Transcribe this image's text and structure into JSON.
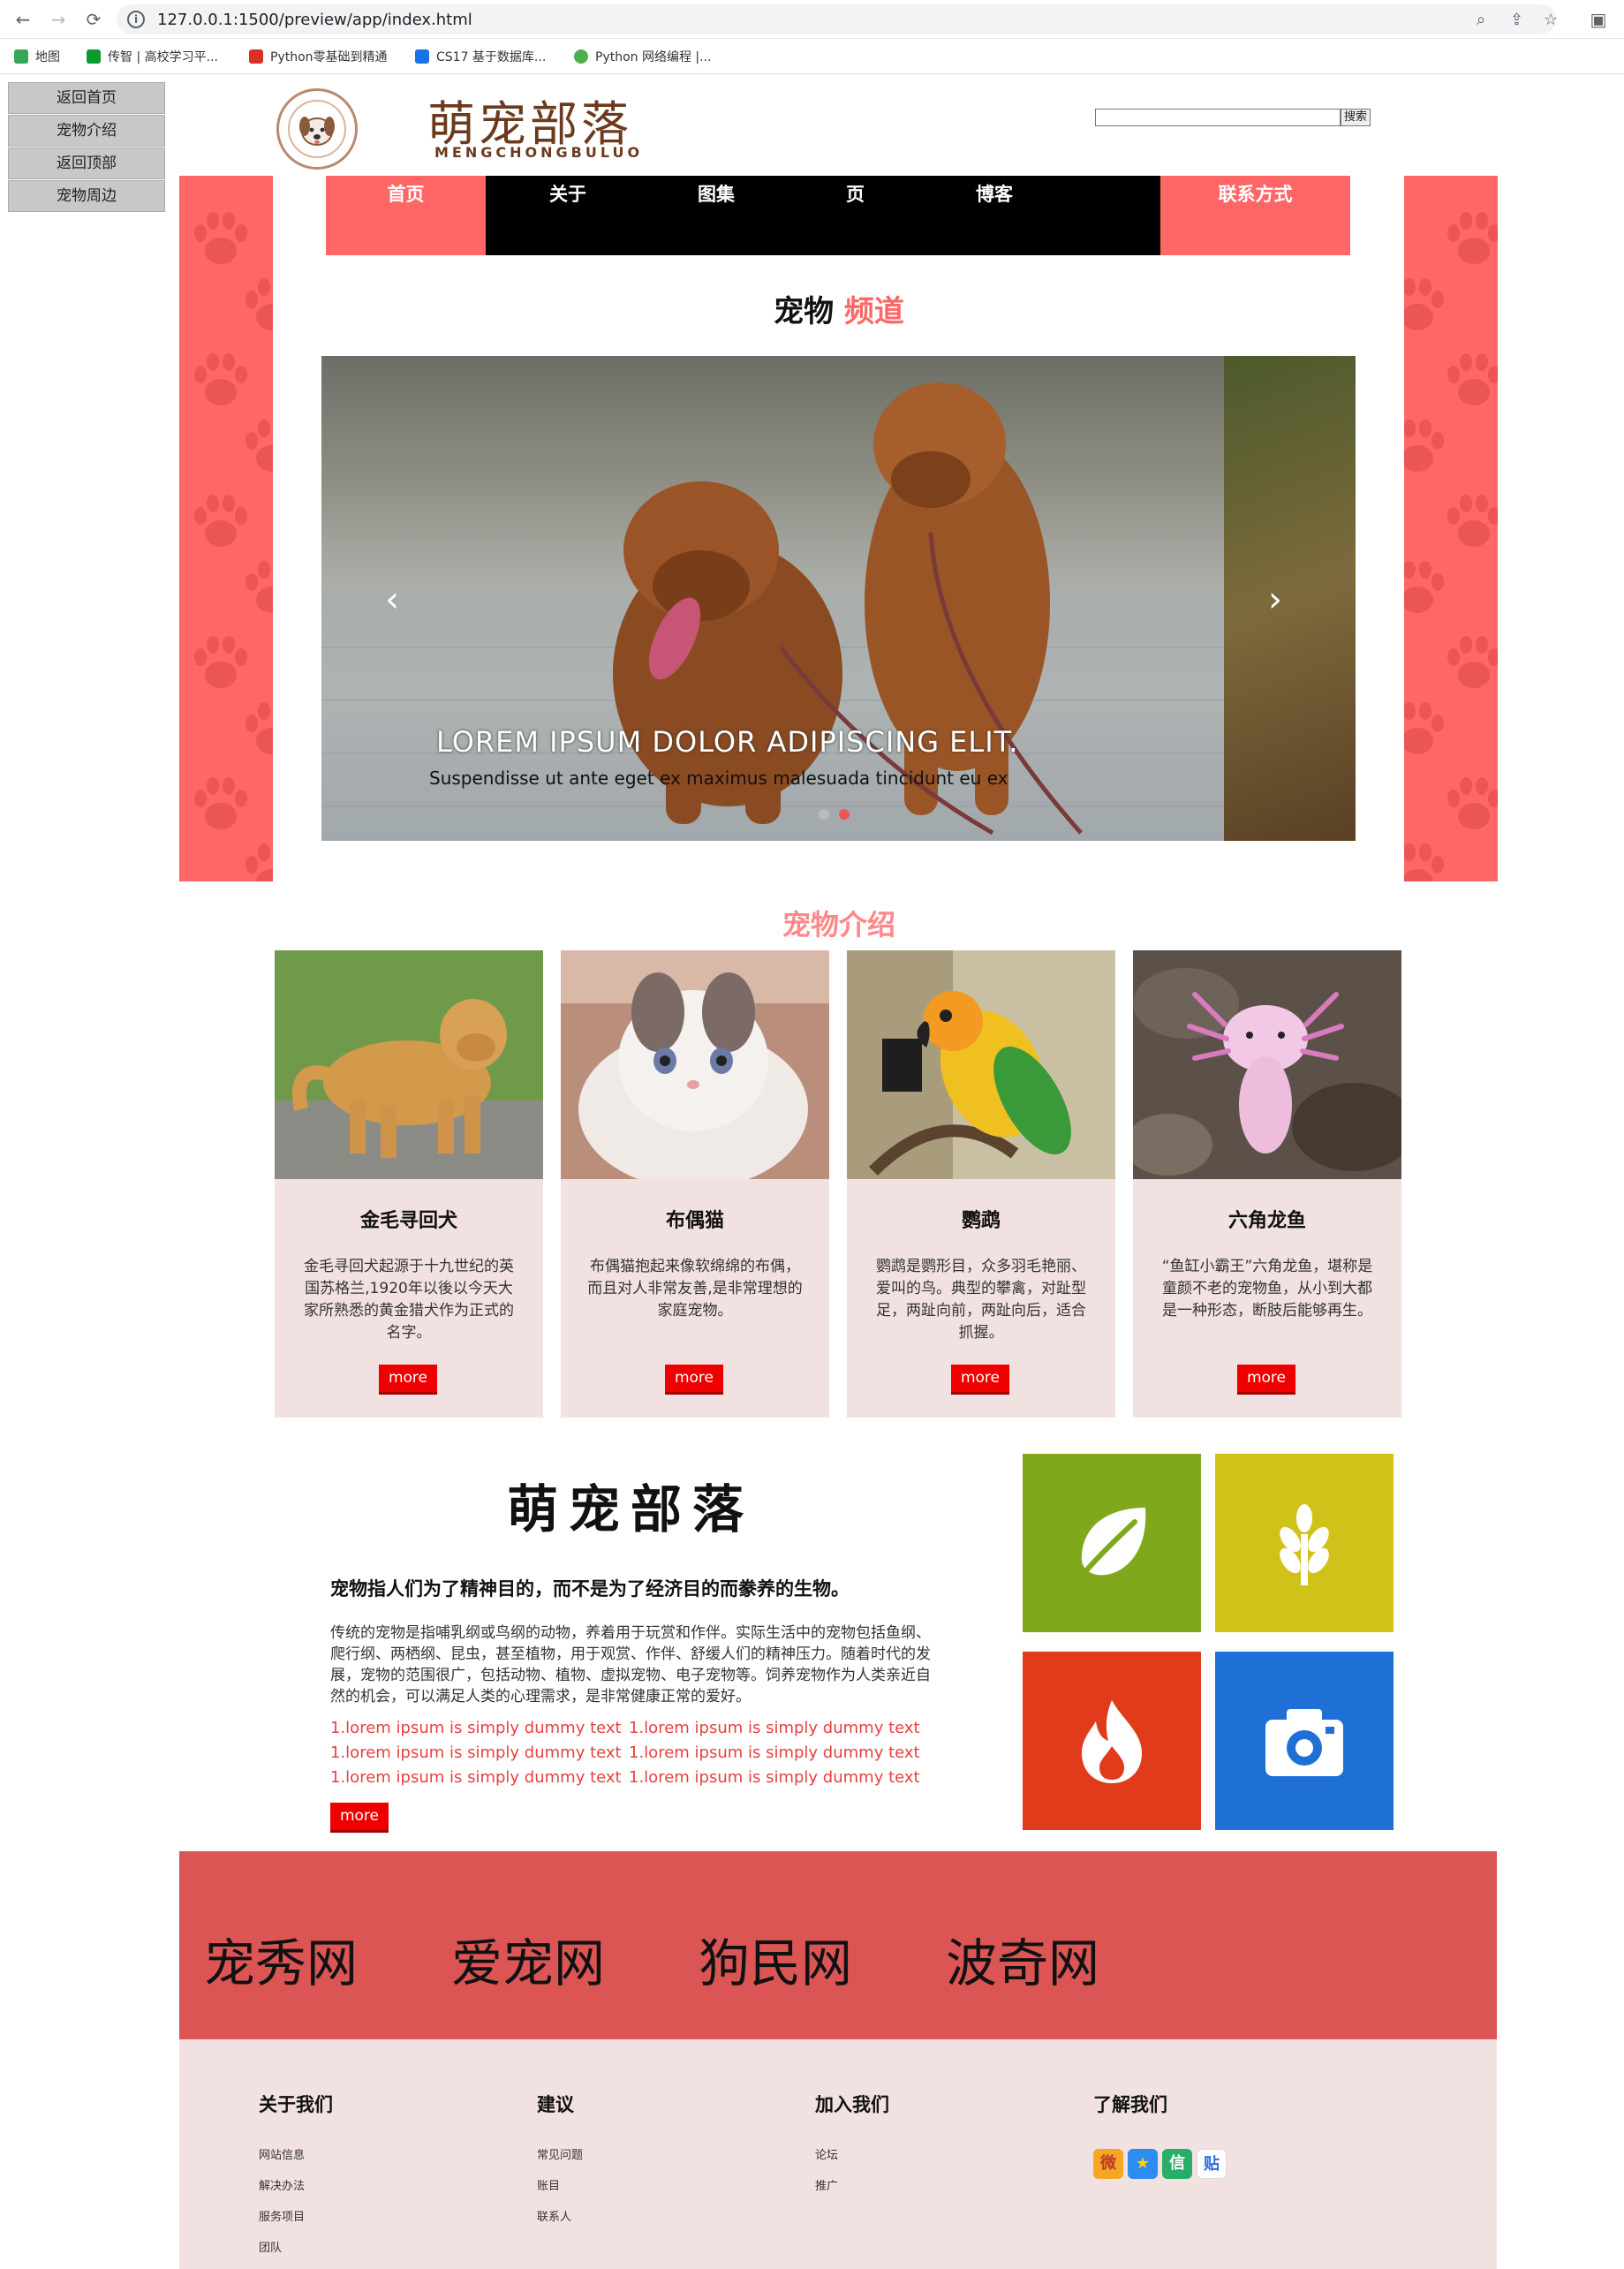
{
  "browser": {
    "url": "127.0.0.1:1500/preview/app/index.html",
    "bookmarks": [
      {
        "label": "地图",
        "color": "#34a853"
      },
      {
        "label": "传智 | 高校学习平...",
        "color": "#0c9a2e"
      },
      {
        "label": "Python零基础到精通",
        "color": "#d93025"
      },
      {
        "label": "CS17 基于数据库...",
        "color": "#1a73e8"
      },
      {
        "label": "Python 网络编程 |...",
        "color": "#4caf50"
      }
    ]
  },
  "side_menu": [
    "返回首页",
    "宠物介绍",
    "返回顶部",
    "宠物周边"
  ],
  "header": {
    "logo_title": "萌宠部落",
    "logo_subtitle": "MENGCHONGBULUO",
    "search_button": "搜索",
    "search_value": ""
  },
  "nav": [
    "首页",
    "关于",
    "图集",
    "页",
    "博客",
    "联系方式"
  ],
  "channel": {
    "title_main": "宠物",
    "title_highlight": "频道"
  },
  "carousel": {
    "caption": "LOREM IPSUM DOLOR ADIPISCING ELIT.",
    "subcaption": "Suspendisse ut ante eget ex maximus malesuada tincidunt eu ex",
    "prev_icon": "‹",
    "next_icon": "›",
    "active_dot": 1,
    "dot_count": 2
  },
  "intro": {
    "title": "宠物介绍",
    "pets": [
      {
        "name": "金毛寻回犬",
        "desc": "金毛寻回犬起源于十九世纪的英国苏格兰,1920年以後以今天大家所熟悉的黄金猎犬作为正式的名字。",
        "more": "more"
      },
      {
        "name": "布偶猫",
        "desc": "布偶猫抱起来像软绵绵的布偶，而且对人非常友善,是非常理想的家庭宠物。",
        "more": "more"
      },
      {
        "name": "鹦鹉",
        "desc": "鹦鹉是鹦形目，众多羽毛艳丽、爱叫的鸟。典型的攀禽，对趾型足，两趾向前，两趾向后，适合抓握。",
        "more": "more"
      },
      {
        "name": "六角龙鱼",
        "desc": "“鱼缸小霸王”六角龙鱼，堪称是童颜不老的宠物鱼，从小到大都是一种形态，断肢后能够再生。",
        "more": "more"
      }
    ]
  },
  "about": {
    "title": "萌宠部落",
    "lead": "宠物指人们为了精神目的，而不是为了经济目的而豢养的生物。",
    "text": "传统的宠物是指哺乳纲或鸟纲的动物，养着用于玩赏和作伴。实际生活中的宠物包括鱼纲、爬行纲、两栖纲、昆虫，甚至植物，用于观赏、作伴、舒缓人们的精神压力。随着时代的发展，宠物的范围很广，包括动物、植物、虚拟宠物、电子宠物等。饲养宠物作为人类亲近自然的机会，可以满足人类的心理需求，是非常健康正常的爱好。",
    "links": [
      "1.lorem ipsum is simply dummy text",
      "1.lorem ipsum is simply dummy text",
      "1.lorem ipsum is simply dummy text",
      "1.lorem ipsum is simply dummy text",
      "1.lorem ipsum is simply dummy text",
      "1.lorem ipsum is simply dummy text"
    ],
    "more": "more",
    "tiles": [
      {
        "icon": "leaf-icon",
        "color": "#7fa81a"
      },
      {
        "icon": "wheat-icon",
        "color": "#d1c21a"
      },
      {
        "icon": "flame-icon",
        "color": "#e03c1c"
      },
      {
        "icon": "camera-icon",
        "color": "#1e6fd6"
      }
    ]
  },
  "partners": [
    "宠秀网",
    "爱宠网",
    "狗民网",
    "波奇网"
  ],
  "footer": {
    "columns": [
      {
        "title": "关于我们",
        "links": [
          "网站信息",
          "解决办法",
          "服务项目",
          "团队"
        ]
      },
      {
        "title": "建议",
        "links": [
          "常见问题",
          "账目",
          "联系人"
        ]
      },
      {
        "title": "加入我们",
        "links": [
          "论坛",
          "推广"
        ]
      },
      {
        "title": "了解我们",
        "links": []
      }
    ],
    "social": [
      {
        "icon": "weibo-icon",
        "glyph": "微",
        "color": "#f5a623"
      },
      {
        "icon": "qzone-icon",
        "glyph": "★",
        "color": "#2d8cf0"
      },
      {
        "icon": "wechat-icon",
        "glyph": "信",
        "color": "#2aae67"
      },
      {
        "icon": "tieba-icon",
        "glyph": "贴",
        "color": "#ffffff"
      }
    ]
  }
}
